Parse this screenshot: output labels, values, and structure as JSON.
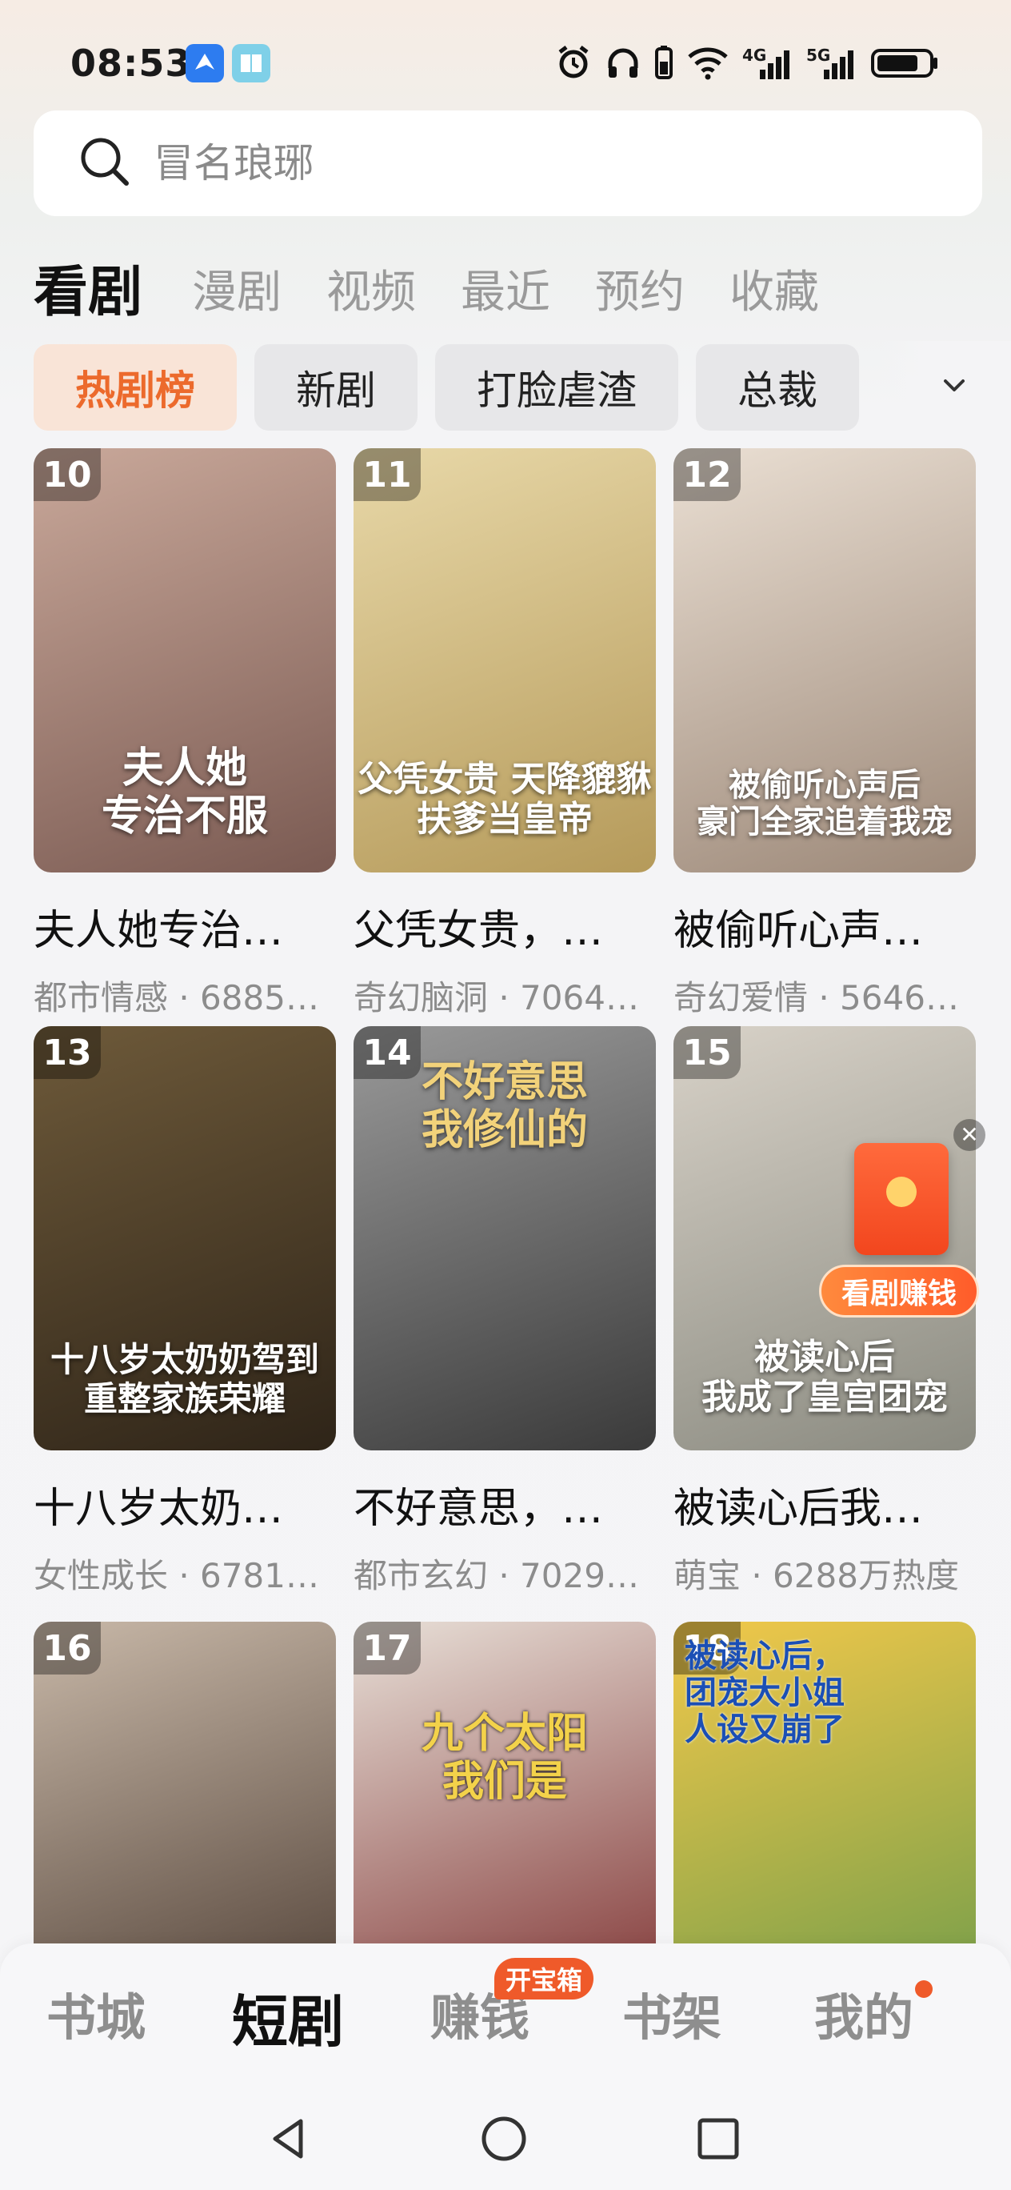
{
  "status_bar": {
    "time": "08:53",
    "network_4g": "4G",
    "network_5g": "5G"
  },
  "search": {
    "placeholder": "冒名琅琊"
  },
  "tabs": [
    {
      "label": "看剧",
      "active": true
    },
    {
      "label": "漫剧"
    },
    {
      "label": "视频"
    },
    {
      "label": "最近"
    },
    {
      "label": "预约"
    },
    {
      "label": "收藏"
    }
  ],
  "chips": [
    {
      "label": "热剧榜",
      "active": true
    },
    {
      "label": "新剧"
    },
    {
      "label": "打脸虐渣"
    },
    {
      "label": "总裁"
    }
  ],
  "dramas": [
    {
      "rank": "10",
      "title": "夫人她专治…",
      "meta": "都市情感 · 6885…",
      "poster_text": "夫人她\n专治不服",
      "colors": [
        "#c9a89a",
        "#7a5a52"
      ]
    },
    {
      "rank": "11",
      "title": "父凭女贵，…",
      "meta": "奇幻脑洞 · 7064…",
      "poster_text": "父凭女贵 天降貔貅\n扶爹当皇帝",
      "colors": [
        "#e8d8a8",
        "#b59a5a"
      ]
    },
    {
      "rank": "12",
      "title": "被偷听心声…",
      "meta": "奇幻爱情 · 5646…",
      "poster_text": "被偷听心声后\n豪门全家追着我宠",
      "colors": [
        "#eadfd3",
        "#9c8878"
      ]
    },
    {
      "rank": "13",
      "title": "十八岁太奶…",
      "meta": "女性成长 · 6781…",
      "poster_text": "十八岁太奶奶驾到\n重整家族荣耀",
      "colors": [
        "#6e5a3a",
        "#2e2418"
      ]
    },
    {
      "rank": "14",
      "title": "不好意思，…",
      "meta": "都市玄幻 · 7029…",
      "poster_text": "不好意思\n我修仙的",
      "colors": [
        "#9a9a9a",
        "#3a3a3a"
      ]
    },
    {
      "rank": "15",
      "title": "被读心后我…",
      "meta": "萌宝 · 6288万热度",
      "poster_text": "被读心后\n我成了皇宫团宠",
      "colors": [
        "#d8d2c8",
        "#8a8a80"
      ]
    },
    {
      "rank": "16",
      "title": "",
      "meta": "",
      "poster_text": "",
      "colors": [
        "#c8b8a8",
        "#4a3a30"
      ]
    },
    {
      "rank": "17",
      "title": "",
      "meta": "",
      "poster_text": "九个太阳\n我们是",
      "colors": [
        "#e8e0d8",
        "#7a2a2a"
      ]
    },
    {
      "rank": "18",
      "title": "",
      "meta": "",
      "poster_text": "被读心后，\n团宠大小姐\n人设又崩了",
      "colors": [
        "#f2c84a",
        "#6a9a4a"
      ]
    }
  ],
  "reward": {
    "label": "看剧赚钱"
  },
  "bottom_nav": [
    {
      "label": "书城"
    },
    {
      "label": "短剧",
      "active": true
    },
    {
      "label": "赚钱",
      "badge": "开宝箱"
    },
    {
      "label": "书架"
    },
    {
      "label": "我的",
      "dot": true
    }
  ]
}
